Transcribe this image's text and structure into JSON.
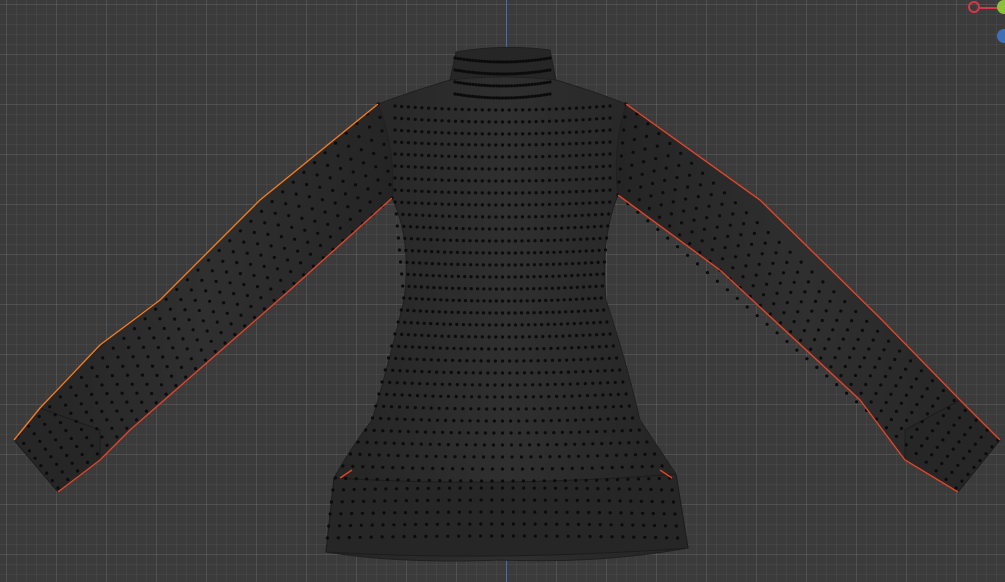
{
  "viewport": {
    "background": "#3b3b3b",
    "z_axis_color": "#3f6fb5",
    "mesh_fill": "#2a2a2a",
    "mesh_edge": "#202020",
    "vertex_color": "#0b0b0b",
    "seam_color": "#e0452a",
    "selected_edge_color": "#f07a22"
  },
  "gizmo": {
    "x_axis_color": "#d2384a",
    "y_axis_color": "#8bc13a",
    "z_axis_color": "#3f6fb5"
  },
  "object": {
    "icon": "sweater-mesh"
  }
}
